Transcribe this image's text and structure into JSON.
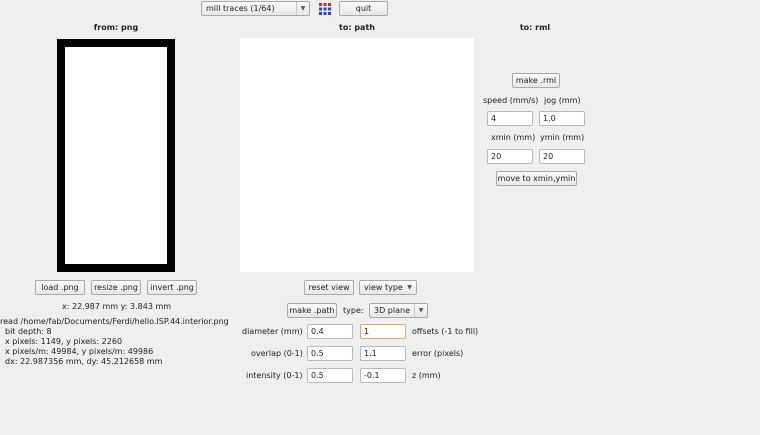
{
  "toolbar": {
    "mode_select": "mill traces (1/64)",
    "quit_label": "quit",
    "grid_icon": "grid-dots-icon",
    "grid_colors": [
      "#e02020",
      "#2040e0"
    ]
  },
  "png_panel": {
    "header": "from: png",
    "load_label": "load .png",
    "resize_label": "resize .png",
    "invert_label": "invert .png",
    "coords": "x: 22.987 mm  y: 3.843 mm",
    "info_lines": [
      "read /home/fab/Documents/Ferdi/hello.ISP.44.interior.png",
      "bit depth: 8",
      "x pixels: 1149, y pixels: 2260",
      "x pixels/m: 49984, y pixels/m: 49986",
      "dx: 22.987356 mm, dy: 45.212658 mm"
    ]
  },
  "path_panel": {
    "header": "to: path",
    "reset_view_label": "reset view",
    "view_type_select": "view type",
    "make_path_label": "make .path",
    "type_label": "type:",
    "type_select": "3D plane",
    "diameter_label": "diameter (mm)",
    "diameter_value": "0.4",
    "offsets_value": "1",
    "offsets_label": "offsets (-1 to fill)",
    "overlap_label": "overlap (0-1)",
    "overlap_value": "0.5",
    "error_value": "1.1",
    "error_label": "error (pixels)",
    "intensity_label": "intensity (0-1)",
    "intensity_value": "0.5",
    "z_value": "-0.1",
    "z_label": "z (mm)"
  },
  "rml_panel": {
    "header": "to: rml",
    "make_rml_label": "make .rml",
    "speed_label": "speed (mm/s)",
    "jog_label": "jog (mm)",
    "speed_value": "4",
    "jog_value": "1.0",
    "xmin_label": "xmin (mm)",
    "ymin_label": "ymin (mm)",
    "xmin_value": "20",
    "ymin_value": "20",
    "move_label": "move to xmin,ymin"
  }
}
